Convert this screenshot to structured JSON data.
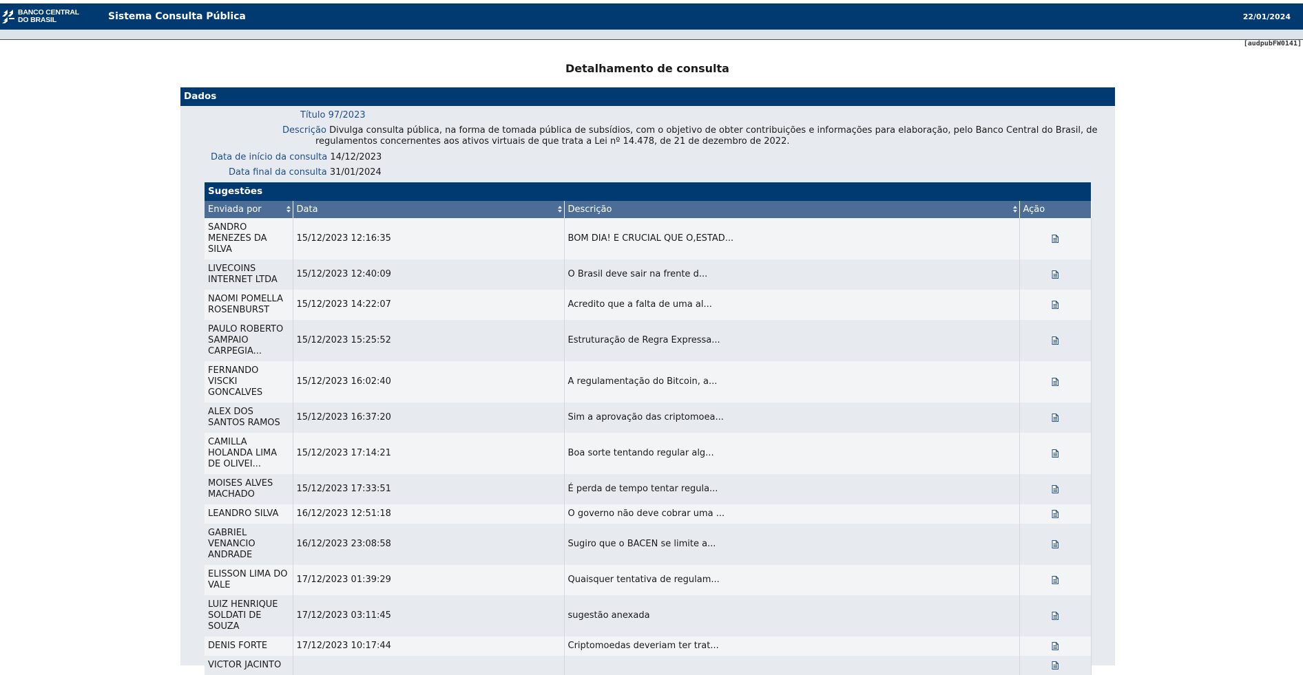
{
  "header": {
    "logo_text_line1": "BANCO CENTRAL",
    "logo_text_line2": "DO BRASIL",
    "system_title": "Sistema Consulta Pública",
    "date": "22/01/2024",
    "page_code": "[audpubFW0141]",
    "page_title": "Detalhamento de consulta"
  },
  "dados": {
    "heading": "Dados",
    "titulo_label": "Título",
    "titulo_value": "97/2023",
    "descricao_label": "Descrição",
    "descricao_line1": "Divulga consulta pública, na forma de tomada pública de subsídios, com o objetivo de obter contribuições e informações para elaboração, pelo Banco Central do Brasil, de",
    "descricao_line2": "regulamentos concernentes aos ativos virtuais de que trata a Lei nº 14.478, de 21 de dezembro de 2022.",
    "inicio_label": "Data de início da consulta",
    "inicio_value": "14/12/2023",
    "final_label": "Data final da consulta",
    "final_value": "31/01/2024"
  },
  "sugestoes": {
    "heading": "Sugestões",
    "columns": [
      "Enviada por",
      "Data",
      "Descrição",
      "Ação"
    ],
    "rows": [
      {
        "enviada_por": "SANDRO MENEZES DA SILVA",
        "data": "15/12/2023 12:16:35",
        "descricao": "BOM DIA! E CRUCIAL QUE O,ESTAD..."
      },
      {
        "enviada_por": "LIVECOINS INTERNET LTDA",
        "data": "15/12/2023 12:40:09",
        "descricao": "O Brasil deve sair na frente d..."
      },
      {
        "enviada_por": "NAOMI POMELLA ROSENBURST",
        "data": "15/12/2023 14:22:07",
        "descricao": "Acredito que a falta de uma al..."
      },
      {
        "enviada_por": "PAULO ROBERTO SAMPAIO CARPEGIA...",
        "data": "15/12/2023 15:25:52",
        "descricao": "Estruturação de Regra Expressa..."
      },
      {
        "enviada_por": "FERNANDO VISCKI GONCALVES",
        "data": "15/12/2023 16:02:40",
        "descricao": "A regulamentação do Bitcoin, a..."
      },
      {
        "enviada_por": "ALEX DOS SANTOS RAMOS",
        "data": "15/12/2023 16:37:20",
        "descricao": "Sim a aprovação das criptomoea..."
      },
      {
        "enviada_por": "CAMILLA HOLANDA LIMA DE OLIVEI...",
        "data": "15/12/2023 17:14:21",
        "descricao": "Boa sorte tentando regular alg..."
      },
      {
        "enviada_por": "MOISES ALVES MACHADO",
        "data": "15/12/2023 17:33:51",
        "descricao": "É perda de tempo tentar regula..."
      },
      {
        "enviada_por": "LEANDRO SILVA",
        "data": "16/12/2023 12:51:18",
        "descricao": "O governo não deve cobrar uma ..."
      },
      {
        "enviada_por": "GABRIEL VENANCIO ANDRADE",
        "data": "16/12/2023 23:08:58",
        "descricao": "Sugiro que o BACEN se limite a..."
      },
      {
        "enviada_por": "ELISSON LIMA DO VALE",
        "data": "17/12/2023 01:39:29",
        "descricao": "Quaisquer tentativa de regulam..."
      },
      {
        "enviada_por": "LUIZ HENRIQUE SOLDATI DE SOUZA",
        "data": "17/12/2023 03:11:45",
        "descricao": "sugestão anexada"
      },
      {
        "enviada_por": "DENIS FORTE",
        "data": "17/12/2023 10:17:44",
        "descricao": "Criptomoedas deveriam ter trat..."
      },
      {
        "enviada_por": "VICTOR JACINTO",
        "data": "",
        "descricao": ""
      }
    ],
    "action_icon": "document-icon"
  },
  "colors": {
    "header_blue": "#003a70",
    "column_header_blue": "#4c6d95",
    "label_blue": "#1f4e8a",
    "panel_bg": "#e7eaee"
  }
}
